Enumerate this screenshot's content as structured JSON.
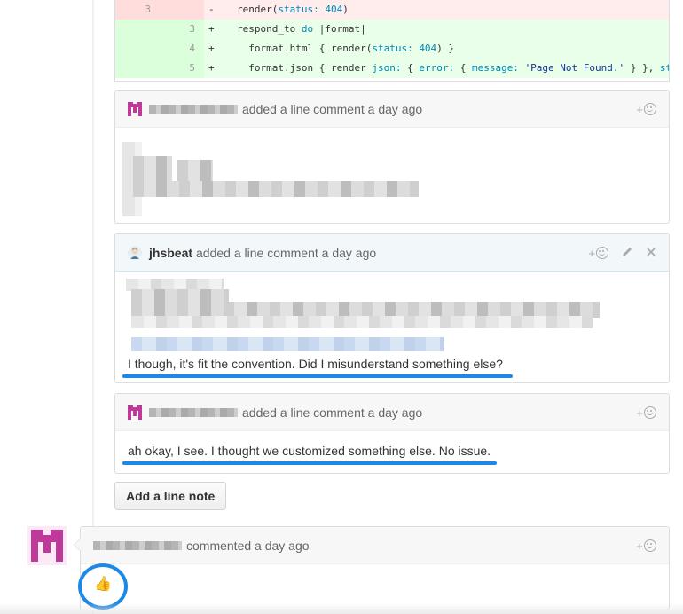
{
  "diff": {
    "rows": [
      {
        "type": "del",
        "old": "3",
        "new": "",
        "sign": "-",
        "code_parts": [
          "render(",
          "status:",
          " ",
          "404",
          ")"
        ]
      },
      {
        "type": "add",
        "old": "",
        "new": "3",
        "sign": "+",
        "code_parts": [
          "respond_to ",
          "do",
          " |format|"
        ]
      },
      {
        "type": "add",
        "old": "",
        "new": "4",
        "sign": "+",
        "code_parts": [
          "  format.html { render(",
          "status:",
          " ",
          "404",
          ") }"
        ]
      },
      {
        "type": "add",
        "old": "",
        "new": "5",
        "sign": "+",
        "code_parts": [
          "  format.json { render ",
          "json:",
          " { ",
          "error:",
          " { ",
          "message:",
          " ",
          "'Page Not Found.'",
          " } }, ",
          "statu"
        ]
      }
    ]
  },
  "comment1": {
    "action": "added a line comment a day ago"
  },
  "comment2": {
    "author": "jhsbeat",
    "action": "added a line comment a day ago",
    "text": "I though, it's fit the convention. Did I misunderstand something else?"
  },
  "comment3": {
    "action": "added a line comment a day ago",
    "text": "ah okay, I see. I thought we customized something else. No issue."
  },
  "add_line_note": "Add a line note",
  "main_comment": {
    "action": "commented a day ago",
    "reaction": "👍"
  },
  "reaction_plus": "+",
  "colors": {
    "accent_blue": "#1e88e5",
    "avatar_pink": "#c0399a"
  },
  "icons": [
    "reaction-icon",
    "pencil-icon",
    "close-icon",
    "thumbs-up-icon"
  ]
}
